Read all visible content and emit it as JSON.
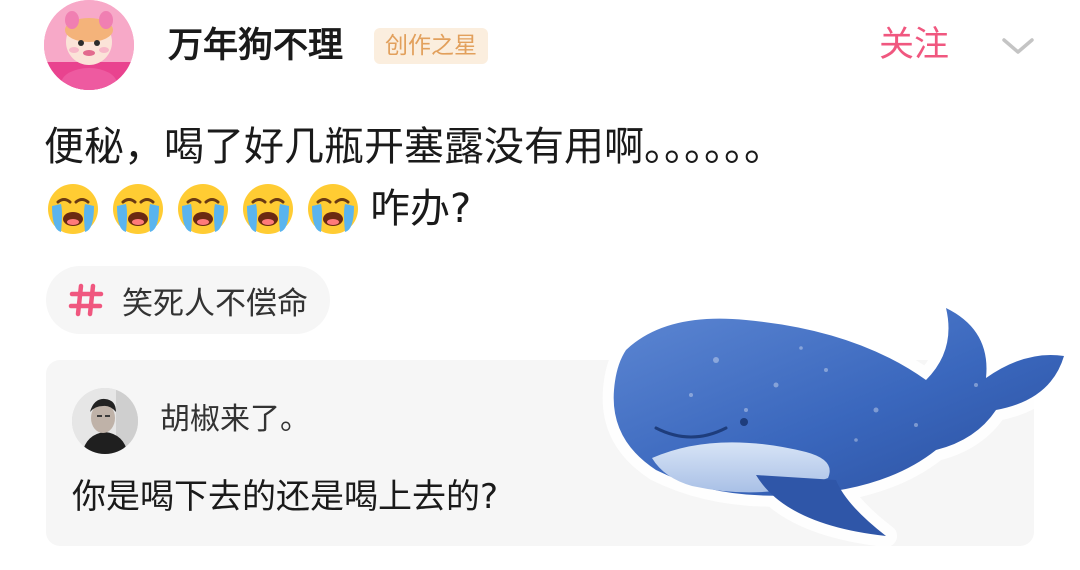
{
  "header": {
    "username": "万年狗不理",
    "badge": "创作之星",
    "follow_label": "关注",
    "chevron_icon": "chevron-down-icon",
    "avatar_icon": "pink-cartoon-avatar"
  },
  "post": {
    "line1": "便秘，喝了好几瓶开塞露没有用啊。。。。。。",
    "emoji": {
      "name": "loudly-crying-face",
      "count": 5
    },
    "line2_suffix": "咋办?"
  },
  "topic": {
    "icon": "hash-icon",
    "label": "笑死人不偿命"
  },
  "comment": {
    "author": "胡椒来了。",
    "text": "你是喝下去的还是喝上去的?"
  },
  "colors": {
    "accent": "#f0577f",
    "badge_text": "#e2a05c",
    "badge_bg": "#fbeede",
    "card_bg": "#f6f6f6",
    "whale_blue": "#3f6fc6"
  }
}
